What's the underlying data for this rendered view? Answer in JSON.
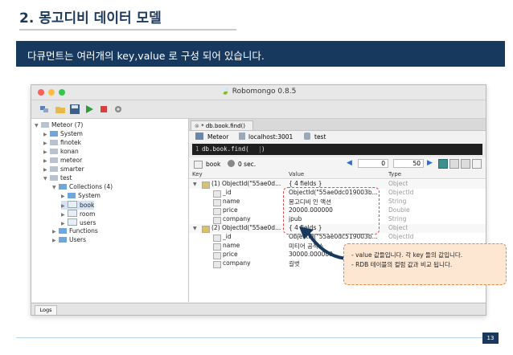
{
  "slide": {
    "title": "2. 몽고디비 데이터 모델",
    "subtitle": "다큐먼트는 여러개의 key,value 로 구성 되어 있습니다.",
    "page_number": "13"
  },
  "window": {
    "title": "Robomongo 0.8.5"
  },
  "sidebar": {
    "items": [
      {
        "label": "Meteor (7)",
        "arrow": "▼"
      },
      {
        "label": "System",
        "arrow": "▶"
      },
      {
        "label": "finotek",
        "arrow": "▶"
      },
      {
        "label": "konan",
        "arrow": "▶"
      },
      {
        "label": "meteor",
        "arrow": "▶"
      },
      {
        "label": "smarter",
        "arrow": "▶"
      },
      {
        "label": "test",
        "arrow": "▼"
      },
      {
        "label": "Collections (4)",
        "arrow": "▼"
      },
      {
        "label": "System",
        "arrow": "▶"
      },
      {
        "label": "book",
        "arrow": "▶"
      },
      {
        "label": "room",
        "arrow": "▶"
      },
      {
        "label": "users",
        "arrow": "▶"
      },
      {
        "label": "Functions",
        "arrow": "▶"
      },
      {
        "label": "Users",
        "arrow": "▶"
      }
    ]
  },
  "tab": {
    "label": "* db.book.find()"
  },
  "connection": {
    "server": "Meteor",
    "host": "localhost:3001",
    "db": "test"
  },
  "query": {
    "line": "1",
    "text": "db.book.find("
  },
  "result": {
    "collection": "book",
    "time": "0 sec.",
    "skip": "0",
    "limit": "50"
  },
  "grid": {
    "headers": {
      "key": "Key",
      "value": "Value",
      "type": "Type"
    },
    "rows": [
      {
        "key": "(1) ObjectId(\"55ae0d...",
        "value": "{ 4 fields }",
        "type": "Object",
        "level": 0
      },
      {
        "key": "_id",
        "value": "ObjectId(\"55ae0dc019003b...",
        "type": "ObjectId",
        "level": 1
      },
      {
        "key": "name",
        "value": "몽고디비 인 액션",
        "type": "String",
        "level": 1
      },
      {
        "key": "price",
        "value": "20000.000000",
        "type": "Double",
        "level": 1
      },
      {
        "key": "company",
        "value": "jpub",
        "type": "String",
        "level": 1
      },
      {
        "key": "(2) ObjectId(\"55ae0d...",
        "value": "{ 4 fields }",
        "type": "Object",
        "level": 0
      },
      {
        "key": "_id",
        "value": "ObjectId(\"55ae0dc519003b...",
        "type": "ObjectId",
        "level": 1
      },
      {
        "key": "name",
        "value": "미티어 공작소",
        "type": "",
        "level": 1
      },
      {
        "key": "price",
        "value": "30000.000000",
        "type": "",
        "level": 1
      },
      {
        "key": "company",
        "value": "길벗",
        "type": "",
        "level": 1
      }
    ]
  },
  "logs": {
    "label": "Logs"
  },
  "callout": {
    "line1": "- value 값들입니다. 각 key 들의 값입니다.",
    "line2": "- RDB 테이블의 컬럼 값과 비교 됩니다."
  },
  "colors": {
    "navy": "#17395e",
    "dashed_red": "#e04a4a",
    "callout_bg": "#fde7d2"
  }
}
